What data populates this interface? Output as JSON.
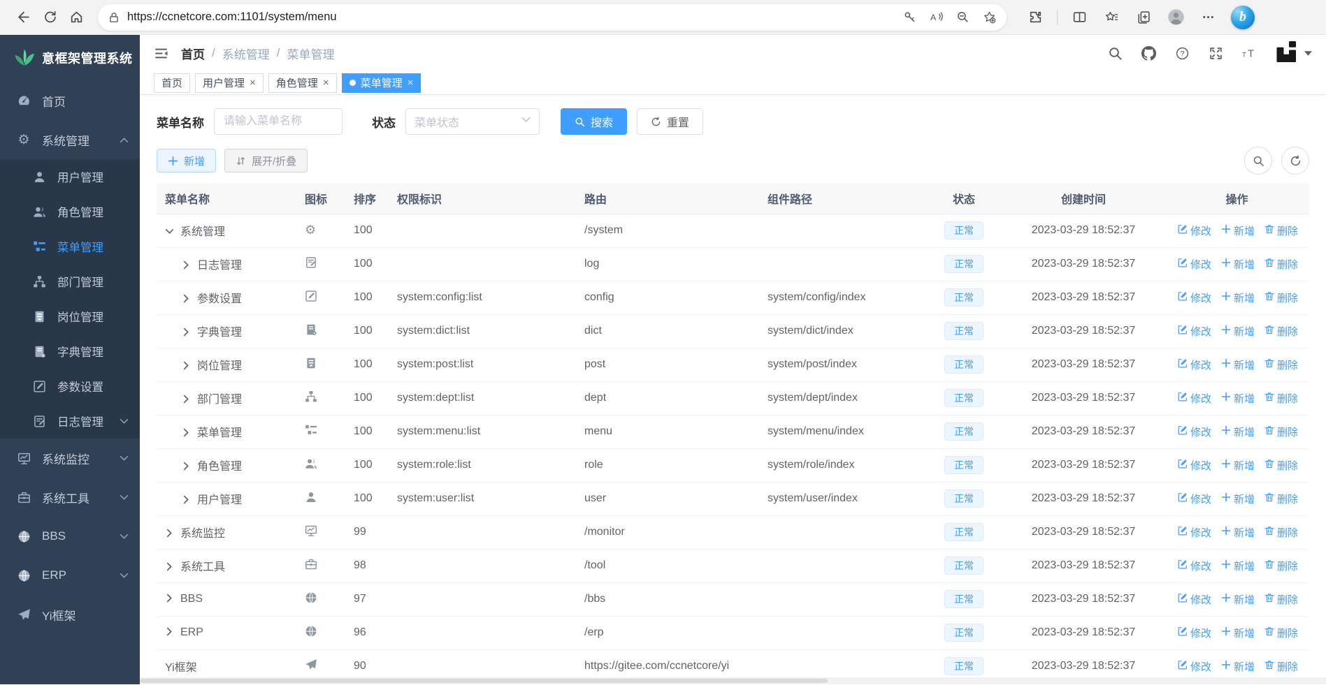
{
  "browser": {
    "url": "https://ccnetcore.com:1101/system/menu",
    "toolbar_icons": [
      "back",
      "refresh",
      "home"
    ],
    "address_icons": [
      "lock",
      "key",
      "read-aloud",
      "zoom-out",
      "favorite-add"
    ],
    "right_icons": [
      "extensions",
      "split-screen",
      "favorites-bar",
      "collections",
      "profile",
      "more",
      "bing"
    ],
    "bing_letter": "b"
  },
  "sidebar": {
    "logo_text": "意框架管理系统",
    "items": [
      {
        "key": "home",
        "label": "首页",
        "icon": "dashboard"
      },
      {
        "key": "system",
        "label": "系统管理",
        "icon": "gear",
        "arrow": "up",
        "children": [
          {
            "key": "user",
            "label": "用户管理",
            "icon": "user"
          },
          {
            "key": "role",
            "label": "角色管理",
            "icon": "users"
          },
          {
            "key": "menu",
            "label": "菜单管理",
            "icon": "tree-table",
            "active": true
          },
          {
            "key": "dept",
            "label": "部门管理",
            "icon": "org-tree"
          },
          {
            "key": "post",
            "label": "岗位管理",
            "icon": "id-card"
          },
          {
            "key": "dict",
            "label": "字典管理",
            "icon": "book"
          },
          {
            "key": "config",
            "label": "参数设置",
            "icon": "pencil-square"
          },
          {
            "key": "log",
            "label": "日志管理",
            "icon": "doc-pencil",
            "arrow": "down"
          }
        ]
      },
      {
        "key": "monitor",
        "label": "系统监控",
        "icon": "monitor",
        "arrow": "down"
      },
      {
        "key": "tool",
        "label": "系统工具",
        "icon": "toolbox",
        "arrow": "down"
      },
      {
        "key": "bbs",
        "label": "BBS",
        "icon": "globe",
        "arrow": "down"
      },
      {
        "key": "erp",
        "label": "ERP",
        "icon": "globe",
        "arrow": "down"
      },
      {
        "key": "yi",
        "label": "Yi框架",
        "icon": "paper-plane"
      }
    ]
  },
  "navbar": {
    "breadcrumb": [
      "首页",
      "系统管理",
      "菜单管理"
    ],
    "right_icons": [
      "search",
      "github",
      "question",
      "fullscreen",
      "font-size",
      "yi-logo",
      "caret-down"
    ]
  },
  "tags": [
    {
      "key": "home",
      "label": "首页",
      "closable": false,
      "active": false
    },
    {
      "key": "user",
      "label": "用户管理",
      "closable": true,
      "active": false
    },
    {
      "key": "role",
      "label": "角色管理",
      "closable": true,
      "active": false
    },
    {
      "key": "menu",
      "label": "菜单管理",
      "closable": true,
      "active": true
    }
  ],
  "filters": {
    "name_label": "菜单名称",
    "name_placeholder": "请输入菜单名称",
    "name_value": "",
    "status_label": "状态",
    "status_placeholder": "菜单状态",
    "search_label": "搜索",
    "reset_label": "重置"
  },
  "toolbar": {
    "add_label": "新增",
    "expand_label": "展开/折叠",
    "right_icons": [
      "search",
      "refresh"
    ]
  },
  "table": {
    "headers": [
      "菜单名称",
      "图标",
      "排序",
      "权限标识",
      "路由",
      "组件路径",
      "状态",
      "创建时间",
      "操作"
    ],
    "ops": {
      "edit": "修改",
      "add": "新增",
      "del": "删除"
    },
    "rows": [
      {
        "name": "系统管理",
        "level": 1,
        "expand": "open",
        "icon": "gear",
        "order": "100",
        "perm": "",
        "route": "/system",
        "component": "",
        "status": "正常",
        "created": "2023-03-29 18:52:37"
      },
      {
        "name": "日志管理",
        "level": 2,
        "expand": "closed",
        "icon": "doc-pencil",
        "order": "100",
        "perm": "",
        "route": "log",
        "component": "",
        "status": "正常",
        "created": "2023-03-29 18:52:37"
      },
      {
        "name": "参数设置",
        "level": 2,
        "expand": "closed",
        "icon": "pencil-square",
        "order": "100",
        "perm": "system:config:list",
        "route": "config",
        "component": "system/config/index",
        "status": "正常",
        "created": "2023-03-29 18:52:37"
      },
      {
        "name": "字典管理",
        "level": 2,
        "expand": "closed",
        "icon": "book",
        "order": "100",
        "perm": "system:dict:list",
        "route": "dict",
        "component": "system/dict/index",
        "status": "正常",
        "created": "2023-03-29 18:52:37"
      },
      {
        "name": "岗位管理",
        "level": 2,
        "expand": "closed",
        "icon": "id-card",
        "order": "100",
        "perm": "system:post:list",
        "route": "post",
        "component": "system/post/index",
        "status": "正常",
        "created": "2023-03-29 18:52:37"
      },
      {
        "name": "部门管理",
        "level": 2,
        "expand": "closed",
        "icon": "org-tree",
        "order": "100",
        "perm": "system:dept:list",
        "route": "dept",
        "component": "system/dept/index",
        "status": "正常",
        "created": "2023-03-29 18:52:37"
      },
      {
        "name": "菜单管理",
        "level": 2,
        "expand": "closed",
        "icon": "tree-table",
        "order": "100",
        "perm": "system:menu:list",
        "route": "menu",
        "component": "system/menu/index",
        "status": "正常",
        "created": "2023-03-29 18:52:37"
      },
      {
        "name": "角色管理",
        "level": 2,
        "expand": "closed",
        "icon": "users",
        "order": "100",
        "perm": "system:role:list",
        "route": "role",
        "component": "system/role/index",
        "status": "正常",
        "created": "2023-03-29 18:52:37"
      },
      {
        "name": "用户管理",
        "level": 2,
        "expand": "closed",
        "icon": "user",
        "order": "100",
        "perm": "system:user:list",
        "route": "user",
        "component": "system/user/index",
        "status": "正常",
        "created": "2023-03-29 18:52:37"
      },
      {
        "name": "系统监控",
        "level": 1,
        "expand": "closed",
        "icon": "monitor",
        "order": "99",
        "perm": "",
        "route": "/monitor",
        "component": "",
        "status": "正常",
        "created": "2023-03-29 18:52:37"
      },
      {
        "name": "系统工具",
        "level": 1,
        "expand": "closed",
        "icon": "toolbox",
        "order": "98",
        "perm": "",
        "route": "/tool",
        "component": "",
        "status": "正常",
        "created": "2023-03-29 18:52:37"
      },
      {
        "name": "BBS",
        "level": 1,
        "expand": "closed",
        "icon": "globe",
        "order": "97",
        "perm": "",
        "route": "/bbs",
        "component": "",
        "status": "正常",
        "created": "2023-03-29 18:52:37"
      },
      {
        "name": "ERP",
        "level": 1,
        "expand": "closed",
        "icon": "globe",
        "order": "96",
        "perm": "",
        "route": "/erp",
        "component": "",
        "status": "正常",
        "created": "2023-03-29 18:52:37"
      },
      {
        "name": "Yi框架",
        "level": 1,
        "expand": "none",
        "icon": "paper-plane",
        "order": "90",
        "perm": "",
        "route": "https://gitee.com/ccnetcore/yi",
        "component": "",
        "status": "正常",
        "created": "2023-03-29 18:52:37"
      }
    ]
  },
  "colors": {
    "accent": "#409eff",
    "sidebar_bg": "#304156",
    "submenu_bg": "#283848",
    "badge_bg": "#ecf5ff",
    "badge_border": "#d9ecff",
    "table_header_bg": "#f8f8f9",
    "tag_active_bg": "#409eff"
  }
}
